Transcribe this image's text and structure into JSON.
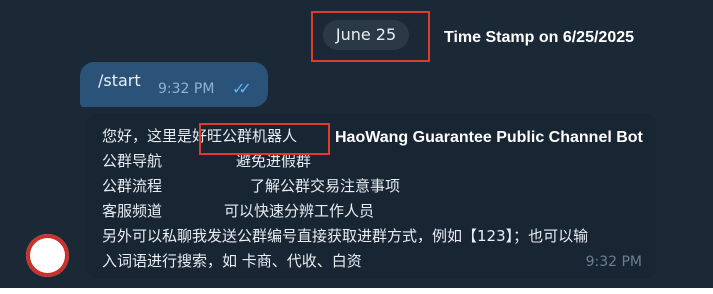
{
  "date_pill": "June 25",
  "annotations": {
    "date": "Time Stamp on 6/25/2025",
    "bot": "HaoWang Guarantee Public Channel Bot"
  },
  "outgoing": {
    "text": "/start",
    "time": "9:32 PM",
    "status_icon": "double-check-icon"
  },
  "incoming": {
    "line1": "您好，这里是好旺公群机器人",
    "line2_label": "公群导航",
    "line2_desc": "避免进假群",
    "line3_label": "公群流程",
    "line3_desc": "了解公群交易注意事项",
    "line4_label": "客服频道",
    "line4_desc": "可以快速分辨工作人员",
    "line5": "另外可以私聊我发送公群编号直接获取进群方式，例如【123】；也可以输",
    "line6": "入词语进行搜索，如 卡商、代收、白资",
    "time": "9:32 PM"
  },
  "colors": {
    "background": "#1b2936",
    "outgoing_bubble": "#2b5278",
    "incoming_bubble": "#182533",
    "annotation_box": "#e03a2d"
  }
}
